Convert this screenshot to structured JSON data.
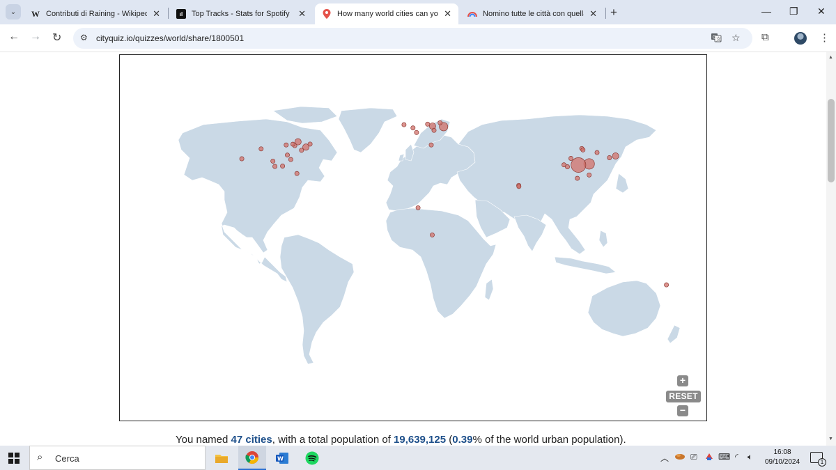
{
  "browser": {
    "tabs": [
      {
        "title": "Contributi di Raining - Wikipedia",
        "favicon": "W"
      },
      {
        "title": "Top Tracks - Stats for Spotify",
        "favicon": "ıl"
      },
      {
        "title": "How many world cities can you name?",
        "favicon": "pin"
      },
      {
        "title": "Nomino tutte le città con quella",
        "favicon": "rainbow"
      }
    ],
    "active_tab": 2,
    "url": "cityquiz.io/quizzes/world/share/1800501"
  },
  "map": {
    "reset_label": "RESET",
    "zoom_in_symbol": "+",
    "zoom_out_symbol": "−",
    "land_color": "#cad9e6",
    "marker_color": "#d1706a",
    "city_markers": [
      {
        "lon": -79.4,
        "lat": 43.7,
        "size": 2
      },
      {
        "lon": -74.0,
        "lat": 40.7,
        "size": 2
      },
      {
        "lon": -71.1,
        "lat": 42.4,
        "size": 1
      },
      {
        "lon": -77.0,
        "lat": 38.9,
        "size": 1
      },
      {
        "lon": -84.4,
        "lat": 33.7,
        "size": 1
      },
      {
        "lon": -87.6,
        "lat": 41.9,
        "size": 1
      },
      {
        "lon": -95.4,
        "lat": 29.8,
        "size": 1
      },
      {
        "lon": -96.8,
        "lat": 32.8,
        "size": 1
      },
      {
        "lon": -90.1,
        "lat": 30.0,
        "size": 1
      },
      {
        "lon": -86.8,
        "lat": 36.2,
        "size": 1
      },
      {
        "lon": -104.9,
        "lat": 39.7,
        "size": 1
      },
      {
        "lon": -118.2,
        "lat": 34.1,
        "size": 1
      },
      {
        "lon": -80.2,
        "lat": 25.8,
        "size": 1
      },
      {
        "lon": -81.7,
        "lat": 41.5,
        "size": 1
      },
      {
        "lon": -83.0,
        "lat": 42.3,
        "size": 1
      },
      {
        "lon": -0.1,
        "lat": 51.5,
        "size": 1
      },
      {
        "lon": 2.35,
        "lat": 48.9,
        "size": 1
      },
      {
        "lon": -6.3,
        "lat": 53.3,
        "size": 1
      },
      {
        "lon": 13.4,
        "lat": 52.5,
        "size": 2
      },
      {
        "lon": 21.0,
        "lat": 52.2,
        "size": 3
      },
      {
        "lon": 18.6,
        "lat": 54.4,
        "size": 1
      },
      {
        "lon": 10.0,
        "lat": 53.6,
        "size": 1
      },
      {
        "lon": 12.5,
        "lat": 41.9,
        "size": 1
      },
      {
        "lon": 14.4,
        "lat": 50.1,
        "size": 1
      },
      {
        "lon": 72.9,
        "lat": 19.1,
        "size": 1
      },
      {
        "lon": 73.0,
        "lat": 18.5,
        "size": 1
      },
      {
        "lon": 3.4,
        "lat": 6.5,
        "size": 1
      },
      {
        "lon": 13.2,
        "lat": -8.8,
        "size": 1
      },
      {
        "lon": 121.5,
        "lat": 31.2,
        "size": 4
      },
      {
        "lon": 114.1,
        "lat": 30.6,
        "size": 6
      },
      {
        "lon": 116.4,
        "lat": 39.9,
        "size": 1
      },
      {
        "lon": 117.2,
        "lat": 39.1,
        "size": 1
      },
      {
        "lon": 113.3,
        "lat": 23.1,
        "size": 1
      },
      {
        "lon": 104.1,
        "lat": 30.7,
        "size": 1
      },
      {
        "lon": 106.5,
        "lat": 29.6,
        "size": 1
      },
      {
        "lon": 126.9,
        "lat": 37.6,
        "size": 1
      },
      {
        "lon": 139.7,
        "lat": 35.7,
        "size": 2
      },
      {
        "lon": 135.5,
        "lat": 34.7,
        "size": 1
      },
      {
        "lon": 121.5,
        "lat": 25.0,
        "size": 1
      },
      {
        "lon": 108.9,
        "lat": 34.3,
        "size": 1
      },
      {
        "lon": 174.8,
        "lat": -36.9,
        "size": 1
      }
    ]
  },
  "summary": {
    "prefix": "You named ",
    "cities": "47 cities",
    "middle": ", with a total population of ",
    "population": "19,639,125",
    "open_paren": " (",
    "percent": "0.39",
    "suffix": "% of the world urban population)."
  },
  "taskbar": {
    "search_placeholder": "Cerca",
    "time": "16:08",
    "date": "09/10/2024",
    "notifications": "1"
  }
}
